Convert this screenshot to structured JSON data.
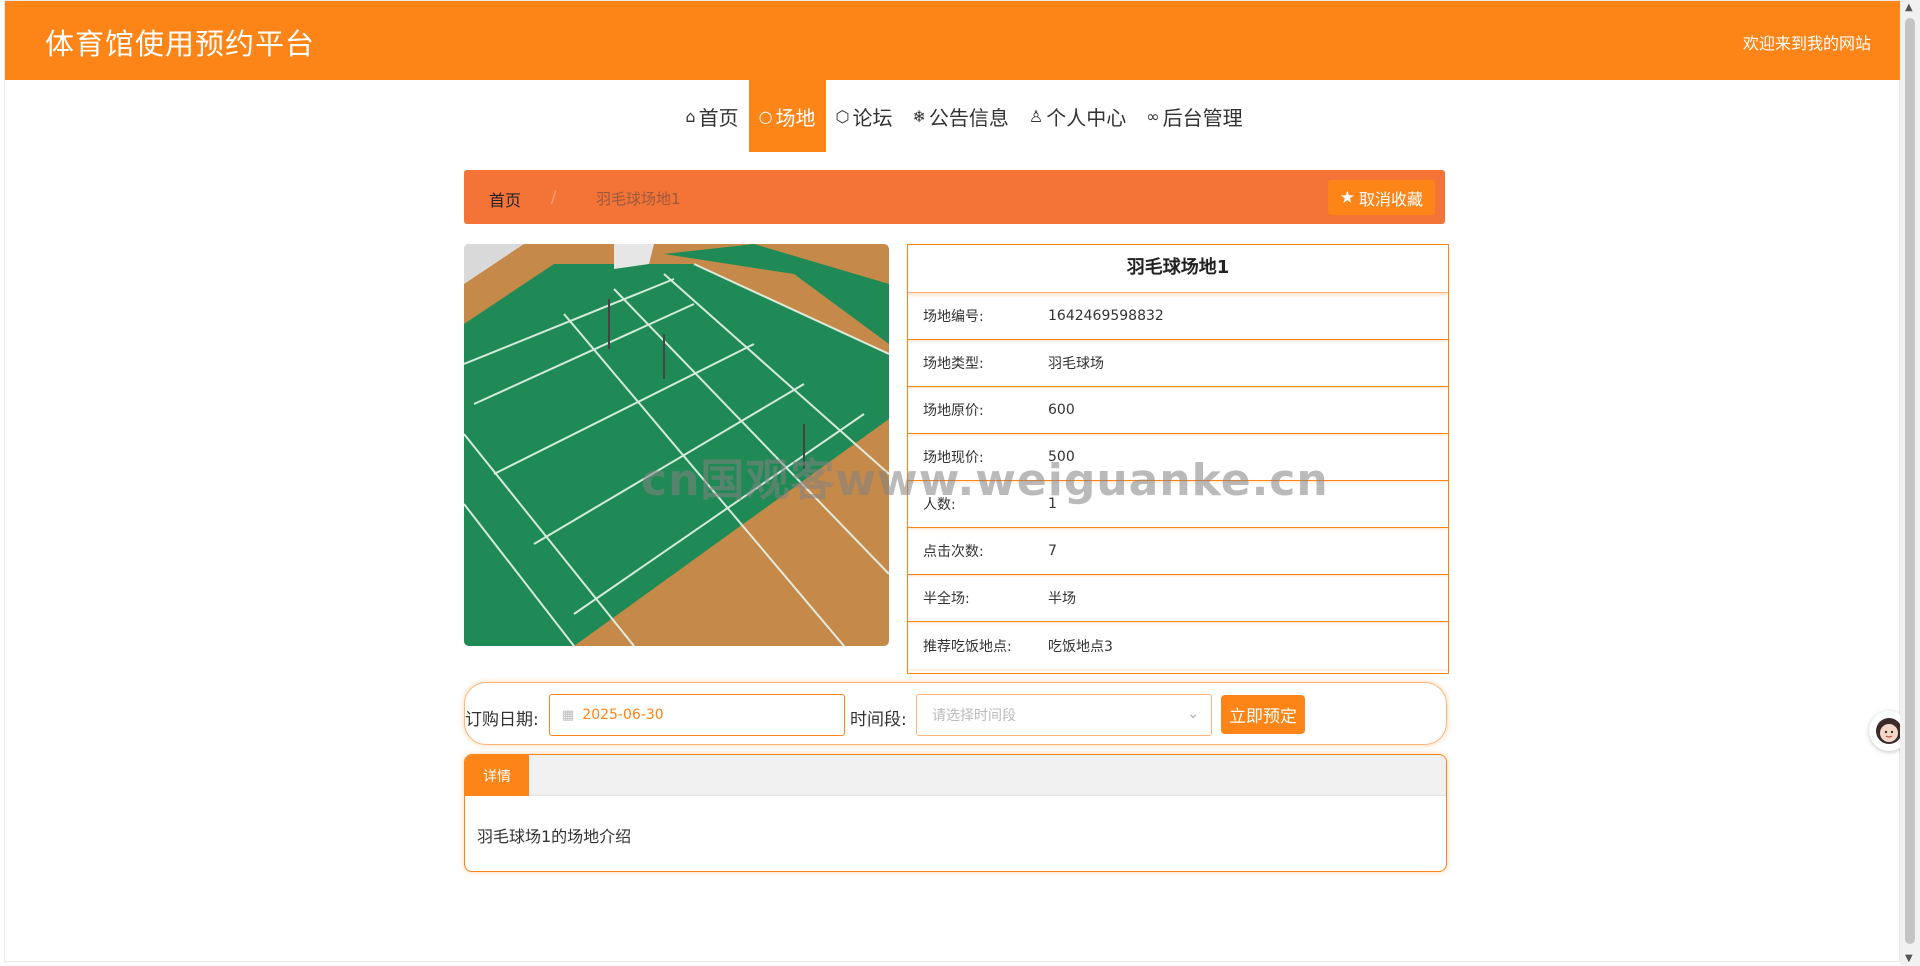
{
  "header": {
    "title": "体育馆使用预约平台",
    "welcome": "欢迎来到我的网站"
  },
  "nav": {
    "items": [
      {
        "icon": "home-icon",
        "label": "首页"
      },
      {
        "icon": "circle-icon",
        "label": "场地"
      },
      {
        "icon": "cube-icon",
        "label": "论坛"
      },
      {
        "icon": "snowflake-icon",
        "label": "公告信息"
      },
      {
        "icon": "user-icon",
        "label": "个人中心"
      },
      {
        "icon": "link-icon",
        "label": "后台管理"
      }
    ],
    "active": "场地"
  },
  "breadcrumb": {
    "home": "首页",
    "separator": "/",
    "current": "羽毛球场地1"
  },
  "favorite_button": {
    "label": "取消收藏",
    "icon": "star-icon"
  },
  "venue": {
    "title": "羽毛球场地1",
    "fields": [
      {
        "label": "场地编号:",
        "value": "1642469598832"
      },
      {
        "label": "场地类型:",
        "value": "羽毛球场"
      },
      {
        "label": "场地原价:",
        "value": "600"
      },
      {
        "label": "场地现价:",
        "value": "500"
      },
      {
        "label": "人数:",
        "value": "1"
      },
      {
        "label": "点击次数:",
        "value": "7"
      },
      {
        "label": "半全场:",
        "value": "半场"
      },
      {
        "label": "推荐吃饭地点:",
        "value": "吃饭地点3"
      }
    ]
  },
  "booking": {
    "date_label": "订购日期:",
    "date_value": "2025-06-30",
    "time_label": "时间段:",
    "time_placeholder": "请选择时间段",
    "submit_label": "立即预定"
  },
  "details": {
    "tab_label": "详情",
    "content": "羽毛球场1的场地介绍"
  },
  "watermark": "cn国观客www.weiguanke.cn",
  "colors": {
    "accent": "#fd8416",
    "breadcrumb_bg": "#f47336",
    "court_green": "#1f8a55",
    "court_wood": "#c58a4a"
  }
}
